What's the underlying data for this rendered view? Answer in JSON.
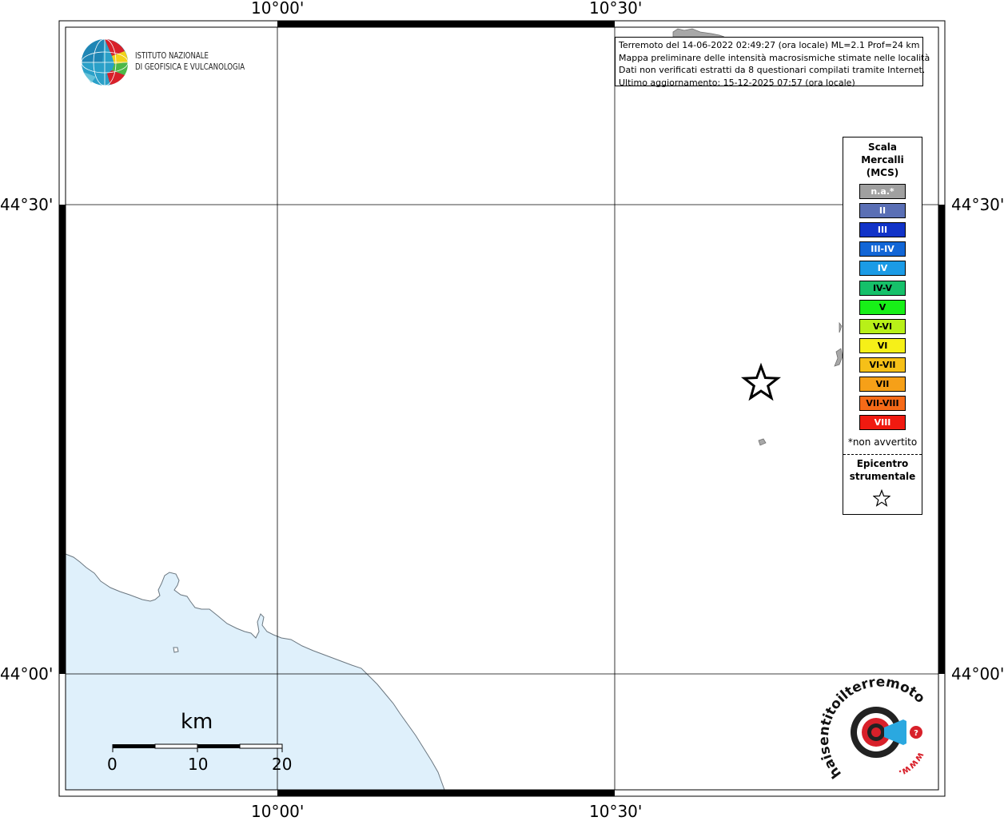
{
  "header": {
    "org_line1": "ISTITUTO NAZIONALE",
    "org_line2": "DI GEOFISICA E VULCANOLOGIA"
  },
  "map": {
    "lon_labels": [
      "10°00'",
      "10°30'"
    ],
    "lat_labels": [
      "44°30'",
      "44°00'"
    ],
    "sea_color": "#dff0fb",
    "epicenter_symbol": "star-icon"
  },
  "info": {
    "line1": "Terremoto del 14-06-2022 02:49:27 (ora locale) ML=2.1 Prof=24 km",
    "line2": "Mappa preliminare delle intensità macrosismiche stimate nelle località",
    "line3": "Dati non verificati estratti da 8 questionari compilati tramite Internet.",
    "line4": "Ultimo aggiornamento: 15-12-2025 07:57 (ora locale)"
  },
  "legend": {
    "title_line1": "Scala",
    "title_line2": "Mercalli",
    "title_line3": "(MCS)",
    "items": [
      {
        "label": "n.a.*",
        "color": "#a0a0a0",
        "text_color": "#ffffff"
      },
      {
        "label": "II",
        "color": "#5a6fb5",
        "text_color": "#ffffff"
      },
      {
        "label": "III",
        "color": "#1133c8",
        "text_color": "#ffffff"
      },
      {
        "label": "III-IV",
        "color": "#1266d6",
        "text_color": "#ffffff"
      },
      {
        "label": "IV",
        "color": "#1b9be6",
        "text_color": "#ffffff"
      },
      {
        "label": "IV-V",
        "color": "#16c06a",
        "text_color": "#000000"
      },
      {
        "label": "V",
        "color": "#18f018",
        "text_color": "#000000"
      },
      {
        "label": "V-VI",
        "color": "#b8f018",
        "text_color": "#000000"
      },
      {
        "label": "VI",
        "color": "#f6f018",
        "text_color": "#000000"
      },
      {
        "label": "VI-VII",
        "color": "#f6c018",
        "text_color": "#000000"
      },
      {
        "label": "VII",
        "color": "#f6a018",
        "text_color": "#000000"
      },
      {
        "label": "VII-VIII",
        "color": "#f66a18",
        "text_color": "#000000"
      },
      {
        "label": "VIII",
        "color": "#f01a10",
        "text_color": "#ffffff"
      }
    ],
    "note": "*non avvertito",
    "epicenter_line1": "Epicentro",
    "epicenter_line2": "strumentale"
  },
  "scale_bar": {
    "unit": "km",
    "labels": [
      "0",
      "10",
      "20"
    ]
  },
  "hsit_logo": {
    "text": "haisentitoilterremoto.it",
    "url_text": "www."
  }
}
